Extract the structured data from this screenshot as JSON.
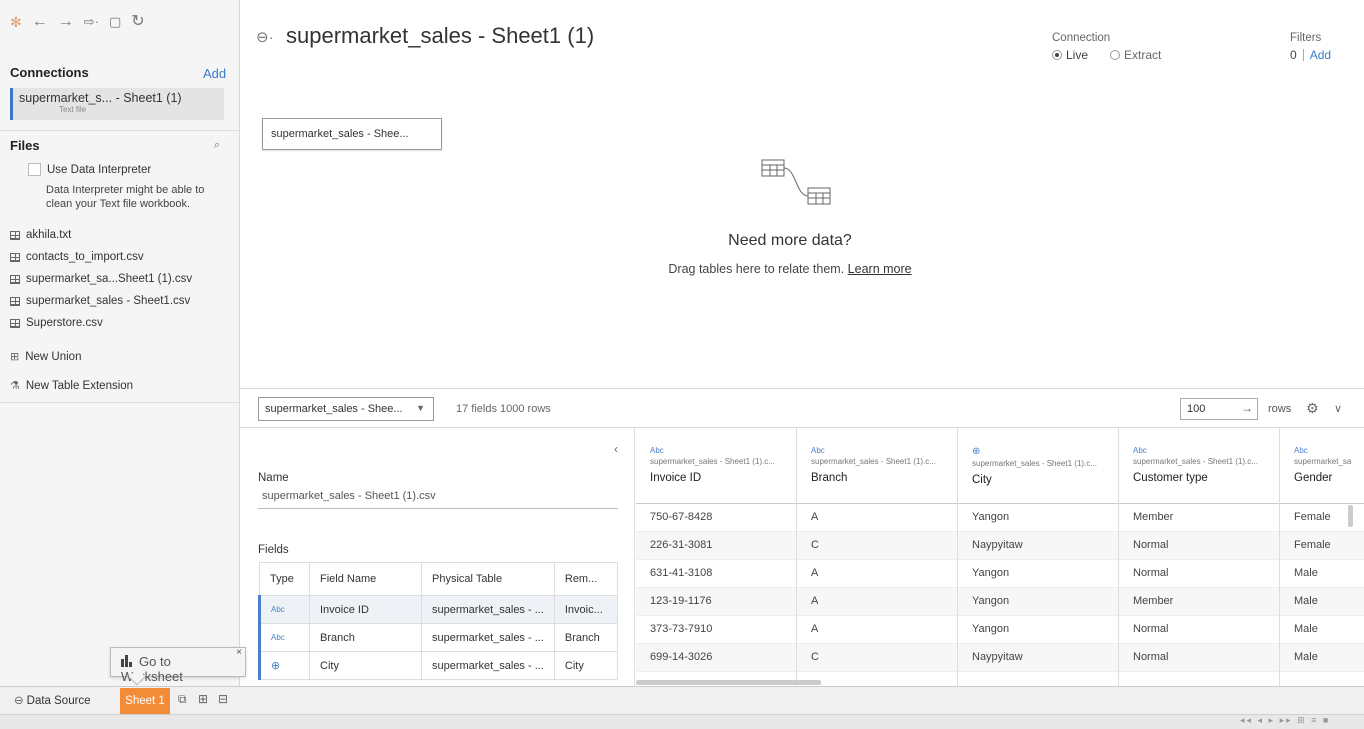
{
  "toolbar": {
    "icons": [
      "logo-icon",
      "back-icon",
      "forward-icon",
      "redo-icon",
      "save-icon",
      "refresh-icon"
    ],
    "glyphs": [
      "✻",
      "←",
      "→",
      "⇨·",
      "▢",
      "↻"
    ]
  },
  "connections": {
    "heading": "Connections",
    "add_label": "Add",
    "item_name": "supermarket_s... - Sheet1 (1)",
    "item_type": "Text file"
  },
  "files": {
    "heading": "Files",
    "search_glyph": "⌕",
    "use_interpreter_label": "Use Data Interpreter",
    "interpreter_note_1": "Data Interpreter might be able to",
    "interpreter_note_2": "clean your Text file workbook.",
    "items": [
      "akhila.txt",
      "contacts_to_import.csv",
      "supermarket_sa...Sheet1 (1).csv",
      "supermarket_sales - Sheet1.csv",
      "Superstore.csv"
    ],
    "new_union": "New Union",
    "new_table_extension": "New Table Extension"
  },
  "main": {
    "title_glyph": "⊖·",
    "title": "supermarket_sales - Sheet1 (1)",
    "connection_label": "Connection",
    "live_label": "Live",
    "extract_label": "Extract",
    "selected_connection": "live",
    "filters_label": "Filters",
    "filters_count": "0",
    "filters_add": "Add",
    "table_chip": "supermarket_sales - Shee...",
    "need_more_title": "Need more data?",
    "need_more_sub": "Drag tables here to relate them.",
    "learn_more": "Learn more"
  },
  "midbar": {
    "table_select": "supermarket_sales - Shee...",
    "fields_rows": "17 fields 1000 rows",
    "rows_value": "100",
    "rows_label": "rows"
  },
  "meta": {
    "name_label": "Name",
    "name_value": "supermarket_sales - Sheet1 (1).csv",
    "fields_label": "Fields",
    "columns": [
      "Type",
      "Field Name",
      "Physical Table",
      "Rem..."
    ],
    "rows": [
      {
        "type": "Abc",
        "field": "Invoice ID",
        "table": "supermarket_sales - ...",
        "rem": "Invoic..."
      },
      {
        "type": "Abc",
        "field": "Branch",
        "table": "supermarket_sales - ...",
        "rem": "Branch"
      },
      {
        "type": "⊕",
        "field": "City",
        "table": "supermarket_sales - ...",
        "rem": "City"
      }
    ]
  },
  "grid": {
    "columns": [
      {
        "type": "Abc",
        "source": "supermarket_sales - Sheet1 (1).c...",
        "name": "Invoice ID",
        "values": [
          "750-67-8428",
          "226-31-3081",
          "631-41-3108",
          "123-19-1176",
          "373-73-7910",
          "699-14-3026"
        ]
      },
      {
        "type": "Abc",
        "source": "supermarket_sales - Sheet1 (1).c...",
        "name": "Branch",
        "values": [
          "A",
          "C",
          "A",
          "A",
          "A",
          "C"
        ]
      },
      {
        "type": "⊕",
        "source": "supermarket_sales - Sheet1 (1).c...",
        "name": "City",
        "values": [
          "Yangon",
          "Naypyitaw",
          "Yangon",
          "Yangon",
          "Yangon",
          "Naypyitaw"
        ]
      },
      {
        "type": "Abc",
        "source": "supermarket_sales - Sheet1 (1).c...",
        "name": "Customer type",
        "values": [
          "Member",
          "Normal",
          "Normal",
          "Member",
          "Normal",
          "Normal"
        ]
      },
      {
        "type": "Abc",
        "source": "supermarket_sa",
        "name": "Gender",
        "values": [
          "Female",
          "Female",
          "Male",
          "Male",
          "Male",
          "Male"
        ]
      }
    ]
  },
  "tooltip": {
    "label": "Go to Worksheet",
    "close": "×"
  },
  "tabs": {
    "data_source": "Data Source",
    "sheet": "Sheet 1"
  },
  "colors": {
    "accent": "#3a7ac8",
    "sheet_tab": "#f28c38"
  }
}
